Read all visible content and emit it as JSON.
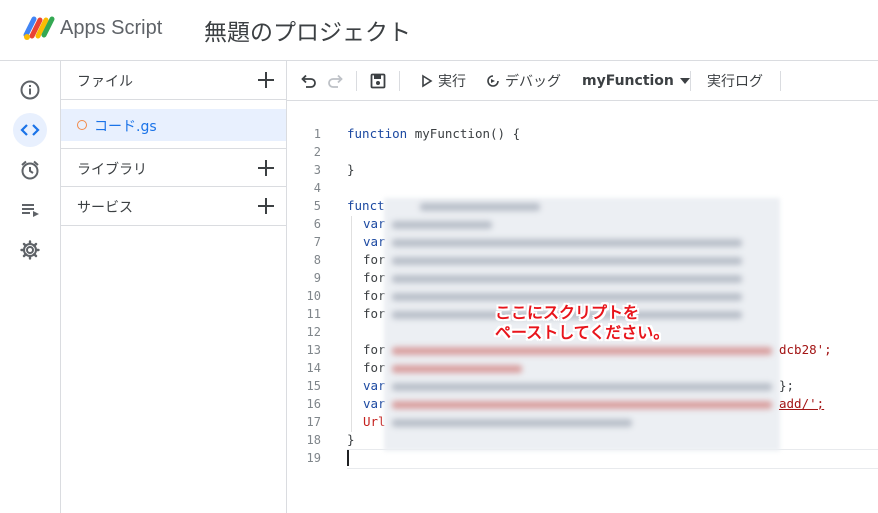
{
  "header": {
    "app_name": "Apps Script",
    "project_title": "無題のプロジェクト"
  },
  "rail": {
    "items": [
      {
        "icon": "info-icon"
      },
      {
        "icon": "code-icon",
        "active": true
      },
      {
        "icon": "alarm-clock-icon"
      },
      {
        "icon": "playlist-run-icon"
      },
      {
        "icon": "gear-icon"
      }
    ]
  },
  "files_panel": {
    "files_label": "ファイル",
    "file_name": "コード.gs",
    "libraries_label": "ライブラリ",
    "services_label": "サービス"
  },
  "toolbar": {
    "run_label": "実行",
    "debug_label": "デバッグ",
    "function_select": "myFunction",
    "execution_log_label": "実行ログ"
  },
  "editor": {
    "line_numbers": [
      "1",
      "2",
      "3",
      "4",
      "5",
      "6",
      "7",
      "8",
      "9",
      "10",
      "11",
      "12",
      "13",
      "14",
      "15",
      "16",
      "17",
      "18",
      "19"
    ],
    "line1_kw": "function",
    "line1_rest": " myFunction() {",
    "line3": "}",
    "line5_partial": "funct",
    "line6_partial": "var",
    "line7_partial": "var",
    "line8_partial": "for",
    "line9_partial": "for",
    "line10_partial": "for",
    "line11_partial": "for",
    "line13_partial": "for",
    "line13_tail": "dcb28';",
    "line14_partial": "for",
    "line15_partial": "var",
    "line15_tail": "};",
    "line16_partial": "var",
    "line16_tail": "add/';",
    "line17_partial": "Url",
    "line18": "}"
  },
  "overlay": {
    "line1": "ここにスクリプトを",
    "line2": "ペーストしてください。"
  },
  "colors": {
    "accent": "#1a73e8",
    "keyword": "#1c49a1",
    "string": "#a31515",
    "annotation": "#e8141b"
  }
}
